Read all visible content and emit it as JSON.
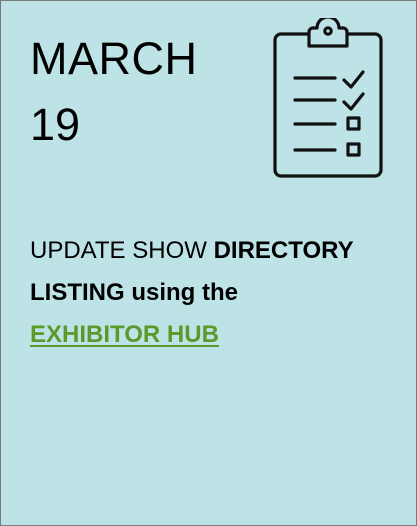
{
  "card": {
    "date_month": "MARCH",
    "date_day": "19",
    "icon": "clipboard-checklist-icon",
    "task_prefix": "UPDATE SHOW",
    "task_bold_1": "DIRECTORY",
    "task_bold_2": "LISTING using the",
    "task_link": "EXHIBITOR HUB",
    "colors": {
      "background": "#bde3e6",
      "link": "#5a9a2b",
      "border": "#7a7a7a"
    }
  }
}
